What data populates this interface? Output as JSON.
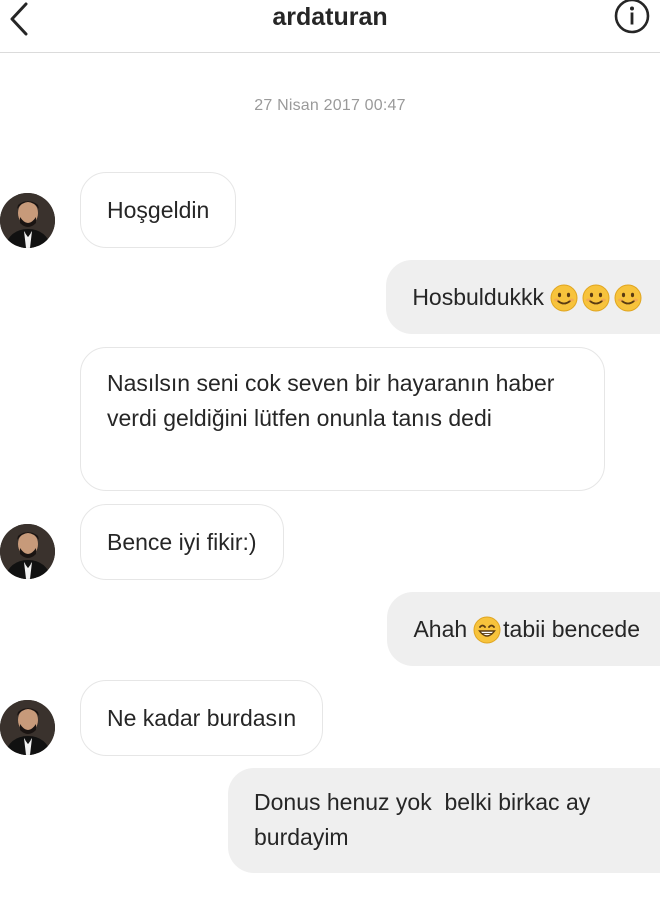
{
  "header": {
    "title": "ardaturan"
  },
  "timestamp": "27 Nisan 2017 00:47",
  "messages": [
    {
      "text": "Hoşgeldin"
    },
    {
      "text": "Hosbuldukkk"
    },
    {
      "text": "Nasılsın seni cok seven bir hayaranın haber verdi geldiğini lütfen onunla tanıs dedi"
    },
    {
      "text": "Bence iyi fikir:)"
    },
    {
      "text_before": "Ahah",
      "text_after": "tabii bencede"
    },
    {
      "text": "Ne kadar burdasın"
    },
    {
      "text": "Donus henuz yok  belki birkac ay burdayim"
    }
  ],
  "icons": {
    "back": "chevron-left-icon",
    "info": "info-icon",
    "emoji_smile": "smiling-face-emoji",
    "emoji_grin": "grinning-face-emoji"
  },
  "colors": {
    "outgoing_bubble": "#efefef",
    "incoming_border": "#e6e6e6",
    "timestamp": "#9a9a9a",
    "emoji": "#f7c33c"
  }
}
